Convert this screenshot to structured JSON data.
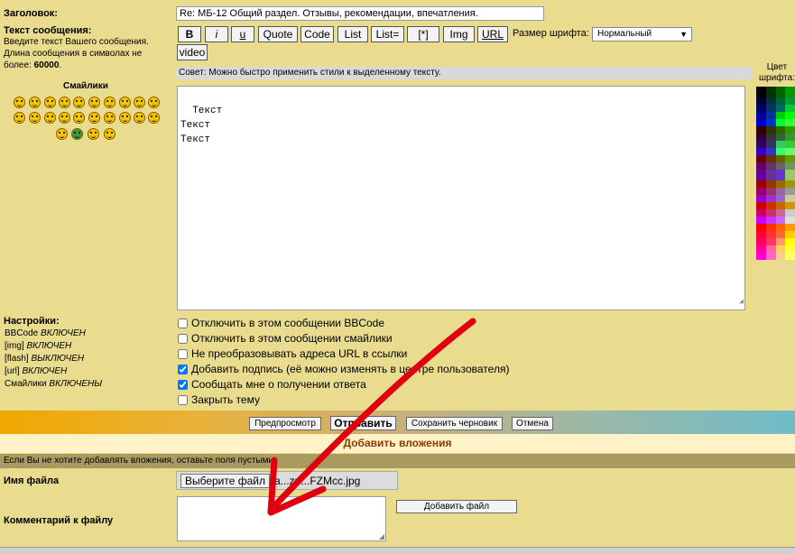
{
  "subject": {
    "label": "Заголовок:",
    "value": "Re: МБ-12 Общий раздел. Отзывы, рекомендации, впечатления."
  },
  "message": {
    "label": "Текст сообщения:",
    "hint": "Введите текст Вашего сообщения. Длина сообщения в символах не более:",
    "max_len": "60000",
    "body": "Текст\nТекст\nТекст"
  },
  "toolbar": {
    "buttons": [
      "B",
      "i",
      "u",
      "Quote",
      "Code",
      "List",
      "List=",
      "[*]",
      "Img",
      "URL"
    ],
    "video": "video",
    "font_size_label": "Размер шрифта:",
    "font_size_value": "Нормальный"
  },
  "tip": "Совет: Можно быстро применить стили к выделенному тексту.",
  "smilies_label": "Смайлики",
  "color_label": "Цвет шрифта:",
  "settings": {
    "label": "Настройки:",
    "status": [
      {
        "key": "BBCode",
        "value": "ВКЛЮЧЕН"
      },
      {
        "key": "[img]",
        "value": "ВКЛЮЧЕН"
      },
      {
        "key": "[flash]",
        "value": "ВЫКЛЮЧЕН"
      },
      {
        "key": "[url]",
        "value": "ВКЛЮЧЕН"
      },
      {
        "key": "Смайлики",
        "value": "ВКЛЮЧЕНЫ"
      }
    ],
    "options": [
      {
        "label": "Отключить в этом сообщении BBCode",
        "checked": false
      },
      {
        "label": "Отключить в этом сообщении смайлики",
        "checked": false
      },
      {
        "label": "Не преобразовывать адреса URL в ссылки",
        "checked": false
      },
      {
        "label": "Добавить подпись (её можно изменять в центре пользователя)",
        "checked": true
      },
      {
        "label": "Сообщать мне о получении ответа",
        "checked": true
      },
      {
        "label": "Закрыть тему",
        "checked": false
      }
    ]
  },
  "actions": {
    "preview": "Предпросмотр",
    "submit": "Отправить",
    "save_draft": "Сохранить черновик",
    "cancel": "Отмена"
  },
  "attachments": {
    "title": "Добавить вложения",
    "hint": "Если Вы не хотите добавлять вложения, оставьте поля пустыми.",
    "filename_label": "Имя файла",
    "choose_file": "Выберите файл",
    "chosen_file": "a...zn...FZMcc.jpg",
    "comment_label": "Комментарий к файлу",
    "add_file": "Добавить файл"
  },
  "colors": {
    "accent_arrow": "#e0000f",
    "banner_title": "#8b3a00"
  }
}
